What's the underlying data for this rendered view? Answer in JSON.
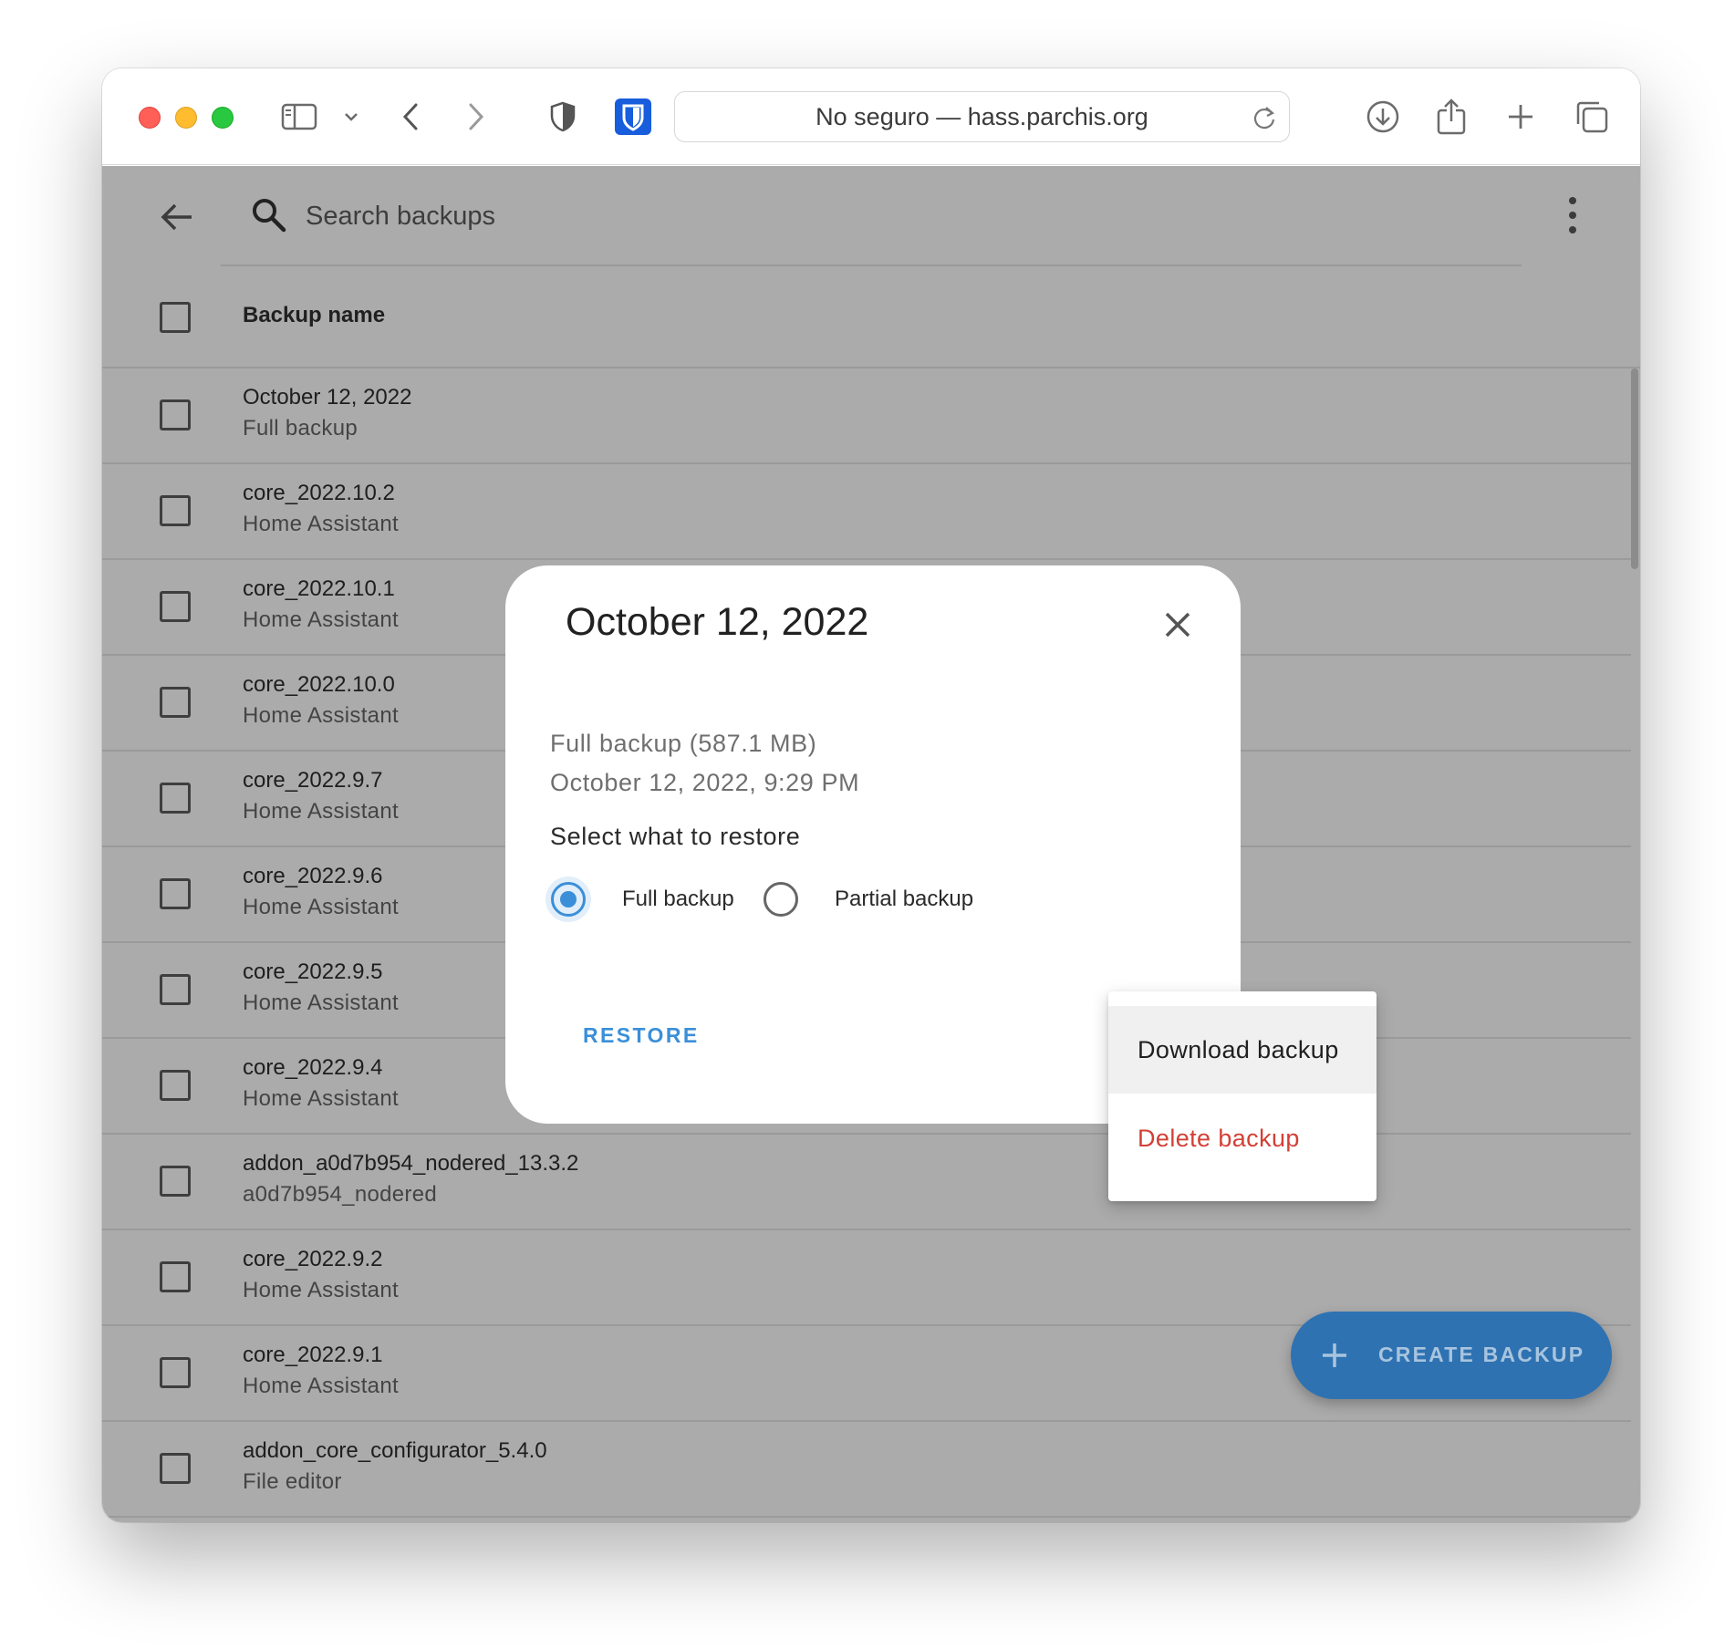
{
  "browser": {
    "url_text": "No seguro — hass.parchis.org"
  },
  "search": {
    "placeholder": "Search backups"
  },
  "table": {
    "header": "Backup name",
    "rows": [
      {
        "name": "October 12, 2022",
        "sub": "Full backup"
      },
      {
        "name": "core_2022.10.2",
        "sub": "Home Assistant"
      },
      {
        "name": "core_2022.10.1",
        "sub": "Home Assistant"
      },
      {
        "name": "core_2022.10.0",
        "sub": "Home Assistant"
      },
      {
        "name": "core_2022.9.7",
        "sub": "Home Assistant"
      },
      {
        "name": "core_2022.9.6",
        "sub": "Home Assistant"
      },
      {
        "name": "core_2022.9.5",
        "sub": "Home Assistant"
      },
      {
        "name": "core_2022.9.4",
        "sub": "Home Assistant"
      },
      {
        "name": "addon_a0d7b954_nodered_13.3.2",
        "sub": "a0d7b954_nodered"
      },
      {
        "name": "core_2022.9.2",
        "sub": "Home Assistant"
      },
      {
        "name": "core_2022.9.1",
        "sub": "Home Assistant"
      },
      {
        "name": "addon_core_configurator_5.4.0",
        "sub": "File editor"
      }
    ]
  },
  "fab": {
    "label": "CREATE BACKUP"
  },
  "dialog": {
    "title": "October 12, 2022",
    "info_type": "Full backup (587.1 MB)",
    "info_date": "October 12, 2022, 9:29 PM",
    "select_label": "Select what to restore",
    "option_full": "Full backup",
    "option_partial": "Partial backup",
    "selected": "full",
    "restore_label": "RESTORE"
  },
  "menu": {
    "download_label": "Download backup",
    "delete_label": "Delete backup"
  },
  "colors": {
    "accent": "#3a8fd8",
    "danger": "#d24035",
    "fab": "#2e72b2"
  }
}
